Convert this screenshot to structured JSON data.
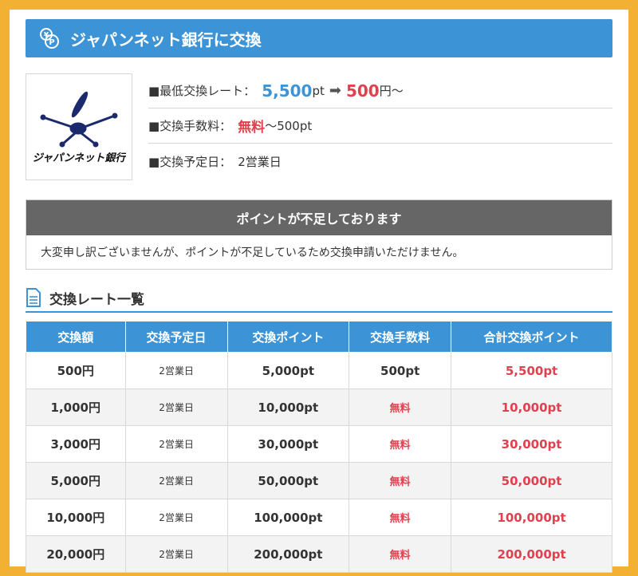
{
  "header": {
    "title": "ジャパンネット銀行に交換"
  },
  "bank": {
    "logo_text": "ジャパンネット銀行"
  },
  "info": {
    "min_rate_label": "■最低交換レート：",
    "min_rate_points": "5,500",
    "min_rate_points_unit": "pt",
    "min_rate_yen": "500",
    "min_rate_yen_unit": "円〜",
    "fee_label": "■交換手数料：",
    "fee_free": "無料",
    "fee_rest": "〜500pt",
    "date_label": "■交換予定日：",
    "date_value": "2営業日"
  },
  "notice": {
    "title": "ポイントが不足しております",
    "body": "大変申し訳ございませんが、ポイントが不足しているため交換申請いただけません。"
  },
  "rate_section": {
    "title": "交換レート一覧"
  },
  "table": {
    "headers": [
      "交換額",
      "交換予定日",
      "交換ポイント",
      "交換手数料",
      "合計交換ポイント"
    ],
    "rows": [
      [
        "500円",
        "2営業日",
        "5,000pt",
        "500pt",
        "5,500pt"
      ],
      [
        "1,000円",
        "2営業日",
        "10,000pt",
        "無料",
        "10,000pt"
      ],
      [
        "3,000円",
        "2営業日",
        "30,000pt",
        "無料",
        "30,000pt"
      ],
      [
        "5,000円",
        "2営業日",
        "50,000pt",
        "無料",
        "50,000pt"
      ],
      [
        "10,000円",
        "2営業日",
        "100,000pt",
        "無料",
        "100,000pt"
      ],
      [
        "20,000円",
        "2営業日",
        "200,000pt",
        "無料",
        "200,000pt"
      ]
    ]
  },
  "colors": {
    "accent": "#3c93d6",
    "frame": "#f2b133",
    "emphasis_red": "#e0414f",
    "notice_head": "#666666"
  }
}
